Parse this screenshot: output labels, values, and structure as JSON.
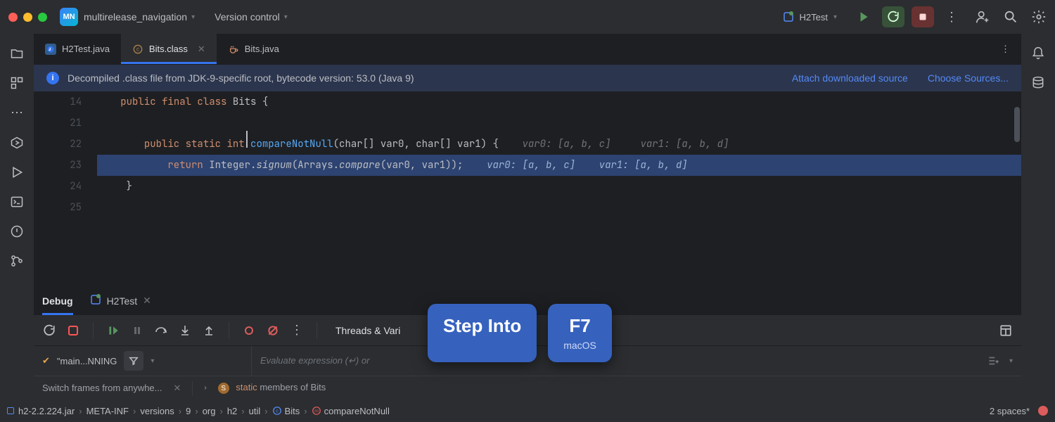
{
  "titlebar": {
    "project_badge": "MN",
    "project_name": "multirelease_navigation",
    "version_control": "Version control",
    "run_config_name": "H2Test"
  },
  "tabs": [
    {
      "label": "H2Test.java",
      "active": false,
      "closable": false
    },
    {
      "label": "Bits.class",
      "active": true,
      "closable": true
    },
    {
      "label": "Bits.java",
      "active": false,
      "closable": false
    }
  ],
  "banner": {
    "text": "Decompiled .class file from JDK-9-specific root, bytecode version: 53.0 (Java 9)",
    "link_attach": "Attach downloaded source",
    "link_choose": "Choose Sources..."
  },
  "editor": {
    "lines": [
      "14",
      "21",
      "22",
      "23",
      "24",
      "25"
    ],
    "l14_kw1": "public",
    "l14_kw2": "final",
    "l14_kw3": "class",
    "l14_cls": "Bits",
    "l14_brace": "{",
    "l22_kw1": "public",
    "l22_kw2": "static",
    "l22_type": "int",
    "l22_mth": "compareNotNull",
    "l22_sig": "(char[] var0, char[] var1) {",
    "l22_hint": "  var0: [a, b, c]     var1: [a, b, d]",
    "l23_kw": "return",
    "l23_cls": "Integer.",
    "l23_sig": "signum",
    "l23_call": "(Arrays.",
    "l23_cmp": "compare",
    "l23_args": "(var0, var1));",
    "l23_hint": "  var0: [a, b, c]    var1: [a, b, d]",
    "l24": "    }"
  },
  "debug": {
    "tab_main": "Debug",
    "tab_session": "H2Test",
    "threads_label": "Threads & Vari",
    "thread_label": "\"main...NNING",
    "eval_placeholder": "Evaluate expression (↵) or",
    "hint_switch": "Switch frames from anywhe...",
    "static_members": "members of Bits",
    "static_label": "static"
  },
  "breadcrumb": [
    "h2-2.2.224.jar",
    "META-INF",
    "versions",
    "9",
    "org",
    "h2",
    "util",
    "Bits",
    "compareNotNull"
  ],
  "status": {
    "indent": "2 spaces*"
  },
  "tooltip": {
    "action": "Step Into",
    "key": "F7",
    "platform": "macOS"
  }
}
